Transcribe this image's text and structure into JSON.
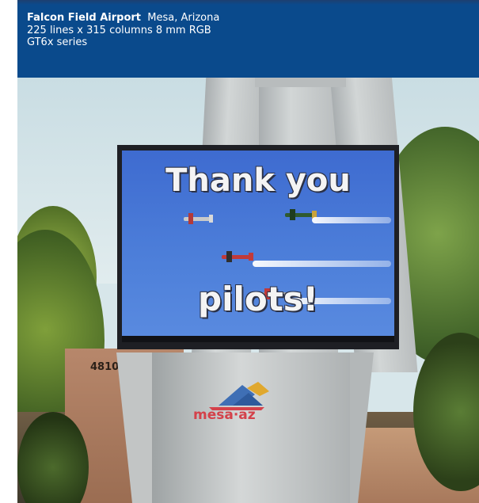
{
  "caption": {
    "name": "Falcon Field Airport",
    "location": "Mesa, Arizona",
    "spec": "225 lines x 315 columns 8 mm RGB",
    "series": "GT6x series",
    "banner_color": "#0a4a8c"
  },
  "scene": {
    "screen_line1": "Thank you",
    "screen_line2": "pilots!",
    "building_number": "4810",
    "logo_text": "mesa·az",
    "screen_color": "#4a78d6",
    "logo_colors": [
      "#3f6fb5",
      "#d4414a",
      "#e0a82e"
    ]
  }
}
